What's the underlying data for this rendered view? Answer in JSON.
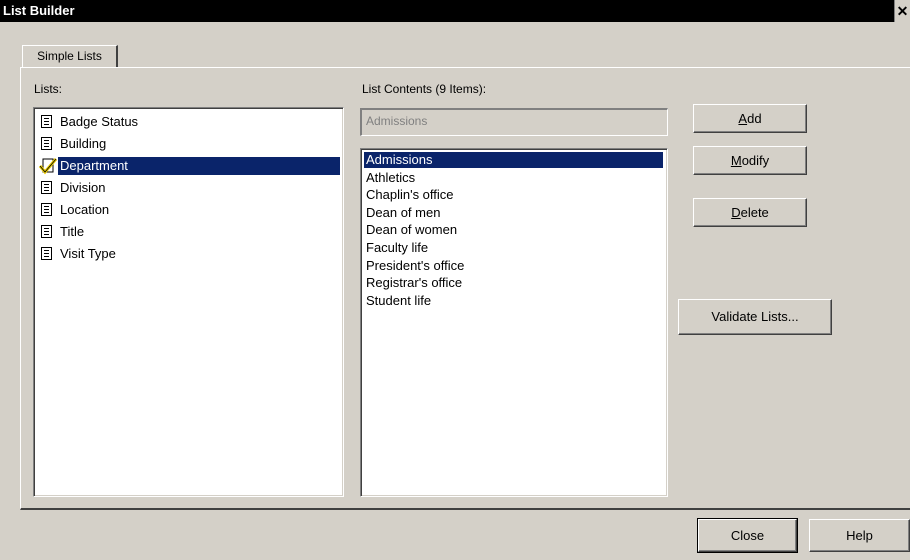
{
  "window": {
    "title": "List Builder",
    "close_glyph": "✕"
  },
  "tabs": [
    {
      "label": "Simple Lists"
    }
  ],
  "lists": {
    "label": "Lists:",
    "items": [
      {
        "label": "Badge Status",
        "icon": "document-list-icon"
      },
      {
        "label": "Building",
        "icon": "document-list-icon"
      },
      {
        "label": "Department",
        "icon": "checkmark-icon",
        "selected": true
      },
      {
        "label": "Division",
        "icon": "document-list-icon"
      },
      {
        "label": "Location",
        "icon": "document-list-icon"
      },
      {
        "label": "Title",
        "icon": "document-list-icon"
      },
      {
        "label": "Visit Type",
        "icon": "document-list-icon"
      }
    ]
  },
  "contents": {
    "label": "List Contents (9 Items):",
    "edit_value": "Admissions",
    "items": [
      "Admissions",
      "Athletics",
      "Chaplin's office",
      "Dean of men",
      "Dean of women",
      "Faculty life",
      "President's office",
      "Registrar's office",
      "Student life"
    ],
    "selected_index": 0
  },
  "buttons": {
    "add": {
      "label_mnemonic": "A",
      "label_rest": "dd"
    },
    "modify": {
      "label_mnemonic": "M",
      "label_rest": "odify"
    },
    "delete": {
      "label_mnemonic": "D",
      "label_rest": "elete"
    },
    "validate": "Validate Lists...",
    "close": "Close",
    "help": "Help"
  },
  "colors": {
    "selection": "#0a246a",
    "face": "#d4d0c8",
    "titlebar": "#000000"
  }
}
